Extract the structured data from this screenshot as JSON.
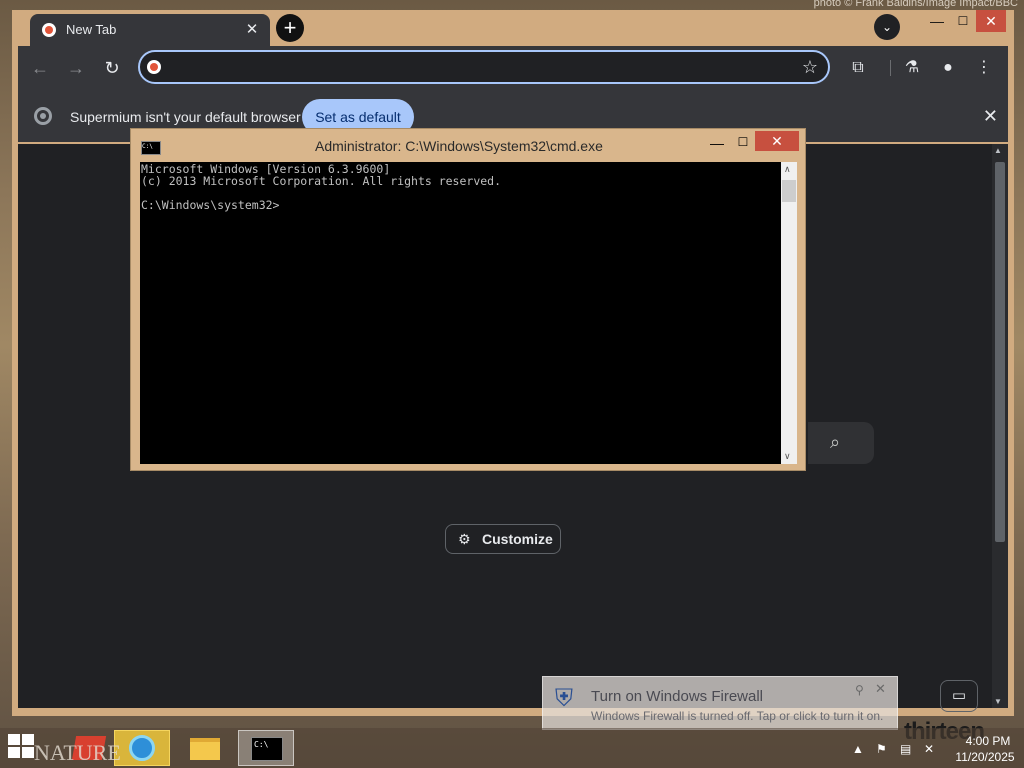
{
  "desktop": {
    "credit": "photo © Frank Baldins/Image Impact/BBC",
    "nature_wordmark": "NATURE",
    "brand": "thirteen"
  },
  "browser": {
    "tab": {
      "title": "New Tab",
      "close": "✕"
    },
    "new_tab": "+",
    "tab_search": "⌄",
    "window_controls": {
      "minimize": "—",
      "maximize": "☐",
      "close": "✕"
    },
    "toolbar": {
      "back": "←",
      "forward": "→",
      "reload": "↻",
      "omnibox_value": "",
      "bookmark": "☆",
      "extensions": "⧉",
      "labs": "⚗",
      "profile": "●",
      "menu": "⋮"
    },
    "infobar": {
      "message": "Supermium isn't your default browser",
      "set_default": "Set as default",
      "close": "✕"
    },
    "ntp": {
      "customize_label": "Customize",
      "customize_icon": "⚙",
      "search_icon": "⌕",
      "chat_icon": "▭"
    }
  },
  "cmd": {
    "title": "Administrator: C:\\Windows\\System32\\cmd.exe",
    "icon_text": "C:\\",
    "lines": "Microsoft Windows [Version 6.3.9600]\n(c) 2013 Microsoft Corporation. All rights reserved.\n\nC:\\Windows\\system32>",
    "controls": {
      "minimize": "—",
      "maximize": "☐",
      "close": "✕"
    }
  },
  "toast": {
    "title": "Turn on Windows Firewall",
    "body": "Windows Firewall is turned off. Tap or click to turn it on.",
    "pin": "⚲",
    "close": "✕"
  },
  "taskbar": {
    "clock_time": "4:00 PM",
    "clock_date": "11/20/2025",
    "tray": [
      "▲",
      "⚑",
      "▤",
      "✕"
    ]
  },
  "colors": {
    "window_frame": "#d1ab80",
    "browser_dark": "#35363a",
    "ntp_bg": "#202124",
    "accent_blue": "#a8c7fa",
    "close_red": "#c7503f"
  }
}
